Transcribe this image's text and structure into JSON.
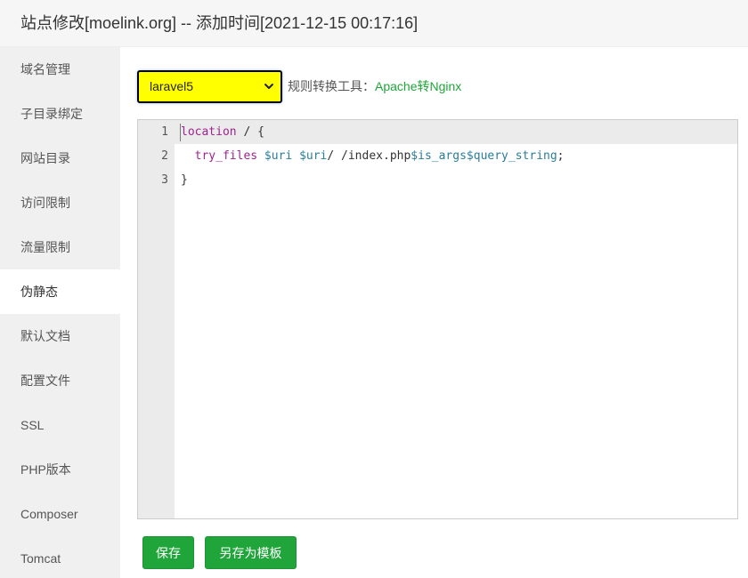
{
  "window": {
    "title": "站点修改[moelink.org] -- 添加时间[2021-12-15 00:17:16]"
  },
  "sidebar": {
    "items": [
      {
        "label": "域名管理",
        "active": false
      },
      {
        "label": "子目录绑定",
        "active": false
      },
      {
        "label": "网站目录",
        "active": false
      },
      {
        "label": "访问限制",
        "active": false
      },
      {
        "label": "流量限制",
        "active": false
      },
      {
        "label": "伪静态",
        "active": true
      },
      {
        "label": "默认文档",
        "active": false
      },
      {
        "label": "配置文件",
        "active": false
      },
      {
        "label": "SSL",
        "active": false
      },
      {
        "label": "PHP版本",
        "active": false
      },
      {
        "label": "Composer",
        "active": false
      },
      {
        "label": "Tomcat",
        "active": false
      }
    ]
  },
  "rewrite": {
    "template_select": {
      "value": "laravel5",
      "icon": "chevron-down-icon"
    },
    "tool_label": "规则转换工具：",
    "tool_link": "Apache转Nginx"
  },
  "editor": {
    "current_line": 1,
    "lines": [
      {
        "num": "1",
        "tokens": [
          {
            "t": "location",
            "c": "kw"
          },
          {
            "t": " / {",
            "c": "plain"
          }
        ]
      },
      {
        "num": "2",
        "tokens": [
          {
            "t": "  try_files",
            "c": "dir"
          },
          {
            "t": " ",
            "c": "plain"
          },
          {
            "t": "$uri",
            "c": "var"
          },
          {
            "t": " ",
            "c": "plain"
          },
          {
            "t": "$uri",
            "c": "var"
          },
          {
            "t": "/ /index.php",
            "c": "plain"
          },
          {
            "t": "$is_args",
            "c": "var"
          },
          {
            "t": "$query_string",
            "c": "var"
          },
          {
            "t": ";",
            "c": "plain"
          }
        ]
      },
      {
        "num": "3",
        "tokens": [
          {
            "t": "}",
            "c": "plain"
          }
        ]
      }
    ]
  },
  "buttons": {
    "save": "保存",
    "save_as_template": "另存为模板"
  },
  "colors": {
    "accent_green": "#20a53a",
    "select_bg": "#ffff00"
  }
}
